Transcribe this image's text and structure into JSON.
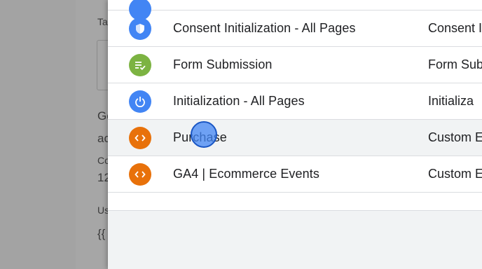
{
  "background": {
    "label_top": "Ta",
    "text_line1": "Go",
    "text_line2": "ac",
    "label_small": "Co",
    "value_small": "12",
    "label_us": "Us",
    "value_braces": "{{"
  },
  "triggers": [
    {
      "name": "",
      "type": "",
      "icon": "blue-circle-icon",
      "color": "#4285f4"
    },
    {
      "name": "Consent Initialization - All Pages",
      "type": "Consent I",
      "icon": "shield-icon",
      "color": "#4285f4"
    },
    {
      "name": "Form Submission",
      "type": "Form Sub",
      "icon": "form-submit-icon",
      "color": "#7cb342"
    },
    {
      "name": "Initialization - All Pages",
      "type": "Initializa",
      "icon": "power-icon",
      "color": "#4285f4"
    },
    {
      "name": "Purchase",
      "type": "Custom E",
      "icon": "code-icon",
      "color": "#e8710a"
    },
    {
      "name": "GA4 | Ecommerce Events",
      "type": "Custom E",
      "icon": "code-icon",
      "color": "#e8710a"
    }
  ]
}
